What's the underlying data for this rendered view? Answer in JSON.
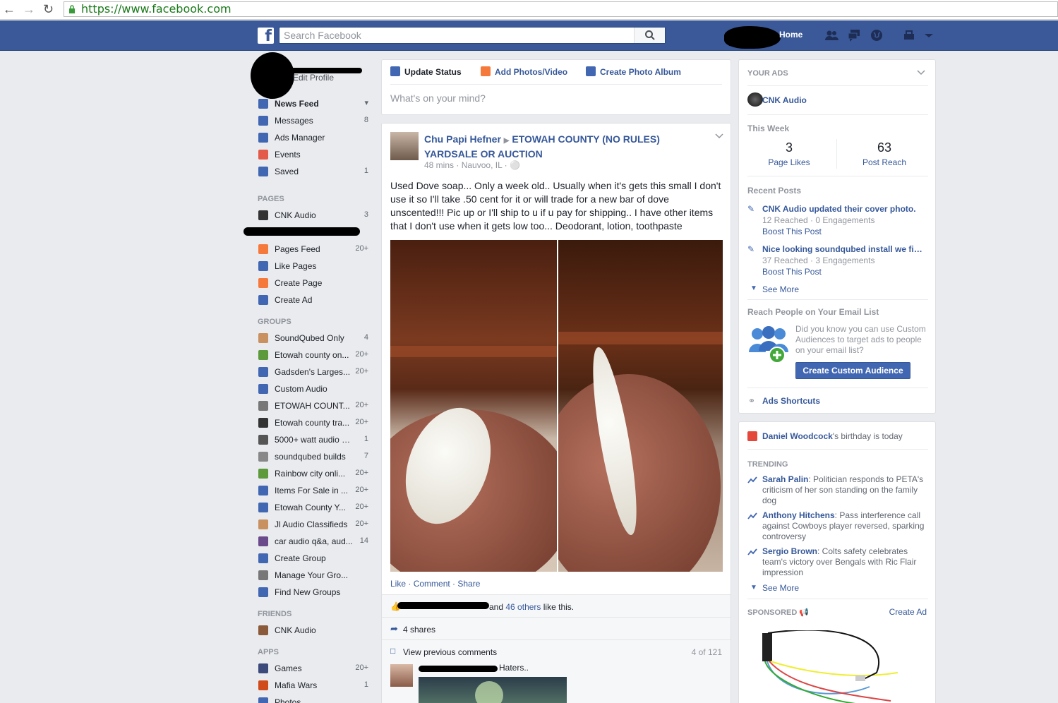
{
  "browser": {
    "url": "https://www.facebook.com"
  },
  "header": {
    "search_placeholder": "Search Facebook",
    "home": "Home",
    "logo_letter": "f"
  },
  "left_nav": {
    "profile_edit": "Edit Profile",
    "main": [
      {
        "label": "News Feed",
        "count": "",
        "color": "#4267b2"
      },
      {
        "label": "Messages",
        "count": "8",
        "color": "#4267b2"
      },
      {
        "label": "Ads Manager",
        "count": "",
        "color": "#4267b2"
      },
      {
        "label": "Events",
        "count": "",
        "color": "#e35a4a"
      },
      {
        "label": "Saved",
        "count": "1",
        "color": "#4267b2"
      }
    ],
    "pages_header": "PAGES",
    "pages": [
      {
        "label": "CNK Audio",
        "count": "3",
        "color": "#333333"
      },
      {
        "label": "Pages Feed",
        "count": "20+",
        "color": "#f5793b"
      },
      {
        "label": "Like Pages",
        "count": "",
        "color": "#4267b2"
      },
      {
        "label": "Create Page",
        "count": "",
        "color": "#f5793b"
      },
      {
        "label": "Create Ad",
        "count": "",
        "color": "#4267b2"
      }
    ],
    "groups_header": "GROUPS",
    "groups": [
      {
        "label": "SoundQubed Only",
        "count": "4",
        "color": "#c9915f"
      },
      {
        "label": "Etowah county on...",
        "count": "20+",
        "color": "#5c9a3c"
      },
      {
        "label": "Gadsden's Larges...",
        "count": "20+",
        "color": "#4267b2"
      },
      {
        "label": "Custom Audio",
        "count": "",
        "color": "#4267b2"
      },
      {
        "label": "ETOWAH COUNT...",
        "count": "20+",
        "color": "#777777"
      },
      {
        "label": "Etowah county tra...",
        "count": "20+",
        "color": "#333333"
      },
      {
        "label": "5000+ watt audio cl...",
        "count": "1",
        "color": "#555555"
      },
      {
        "label": "soundqubed builds",
        "count": "7",
        "color": "#888888"
      },
      {
        "label": "Rainbow city onli...",
        "count": "20+",
        "color": "#5c9a3c"
      },
      {
        "label": "Items For Sale in ...",
        "count": "20+",
        "color": "#4267b2"
      },
      {
        "label": "Etowah County Y...",
        "count": "20+",
        "color": "#4267b2"
      },
      {
        "label": "Jl Audio Classifieds",
        "count": "20+",
        "color": "#c9915f"
      },
      {
        "label": "car audio q&a, aud...",
        "count": "14",
        "color": "#6a4a8a"
      },
      {
        "label": "Create Group",
        "count": "",
        "color": "#4267b2"
      },
      {
        "label": "Manage Your Gro...",
        "count": "",
        "color": "#777777"
      },
      {
        "label": "Find New Groups",
        "count": "",
        "color": "#4267b2"
      }
    ],
    "friends_header": "FRIENDS",
    "friends": [
      {
        "label": "CNK Audio",
        "count": "",
        "color": "#8a5a3a"
      }
    ],
    "apps_header": "APPS",
    "apps": [
      {
        "label": "Games",
        "count": "20+",
        "color": "#3b4a7a"
      },
      {
        "label": "Mafia Wars",
        "count": "1",
        "color": "#d04a1a"
      },
      {
        "label": "Photos",
        "count": "",
        "color": "#4267b2"
      }
    ]
  },
  "composer": {
    "tabs": [
      "Update Status",
      "Add Photos/Video",
      "Create Photo Album"
    ],
    "placeholder": "What's on your mind?"
  },
  "post": {
    "author": "Chu Papi Hefner",
    "group": "ETOWAH COUNTY (NO RULES) YARDSALE OR AUCTION",
    "time": "48 mins",
    "location": "Nauvoo, IL",
    "text": "Used Dove soap... Only a week old.. Usually when it's gets this small I don't use it so I'll take .50 cent for it or will trade for a new bar of dove unscented!!! Pic up or I'll ship to u if u pay for shipping.. I have other items that I don't use when it gets low too... Deodorant, lotion, toothpaste",
    "actions": [
      "Like",
      "Comment",
      "Share"
    ],
    "likes_suffix": "and",
    "likes_others": "46 others",
    "likes_tail": "like this.",
    "shares": "4 shares",
    "view_previous": "View previous comments",
    "comment_count": "4 of 121",
    "comment_text": "Haters.."
  },
  "right": {
    "your_ads": "YOUR ADS",
    "page_name": "CNK Audio",
    "this_week": "This Week",
    "page_likes_num": "3",
    "page_likes_lbl": "Page Likes",
    "post_reach_num": "63",
    "post_reach_lbl": "Post Reach",
    "recent_posts": "Recent Posts",
    "posts": [
      {
        "title": "CNK Audio updated their cover photo.",
        "stats": "12 Reached · 0 Engagements",
        "boost": "Boost This Post"
      },
      {
        "title": "Nice looking soundqubed install we fini...",
        "stats": "37 Reached · 3 Engagements",
        "boost": "Boost This Post"
      }
    ],
    "see_more": "See More",
    "reach_hdr": "Reach People on Your Email List",
    "reach_text": "Did you know you can use Custom Audiences to target ads to people on your email list?",
    "create_audience": "Create Custom Audience",
    "ads_shortcuts": "Ads Shortcuts",
    "birthday_name": "Daniel Woodcock",
    "birthday_tail": "'s birthday is today",
    "trending": "TRENDING",
    "trends": [
      {
        "name": "Sarah Palin",
        "text": ": Politician responds to PETA's criticism of her son standing on the family dog"
      },
      {
        "name": "Anthony Hitchens",
        "text": ": Pass interference call against Cowboys player reversed, sparking controversy"
      },
      {
        "name": "Sergio Brown",
        "text": ": Colts safety celebrates team's victory over Bengals with Ric Flair impression"
      }
    ],
    "trend_see_more": "See More",
    "sponsored": "SPONSORED",
    "create_ad": "Create Ad"
  },
  "colors": {
    "brand": "#3b5998",
    "link": "#365899",
    "page_bg": "#e9ebee"
  }
}
